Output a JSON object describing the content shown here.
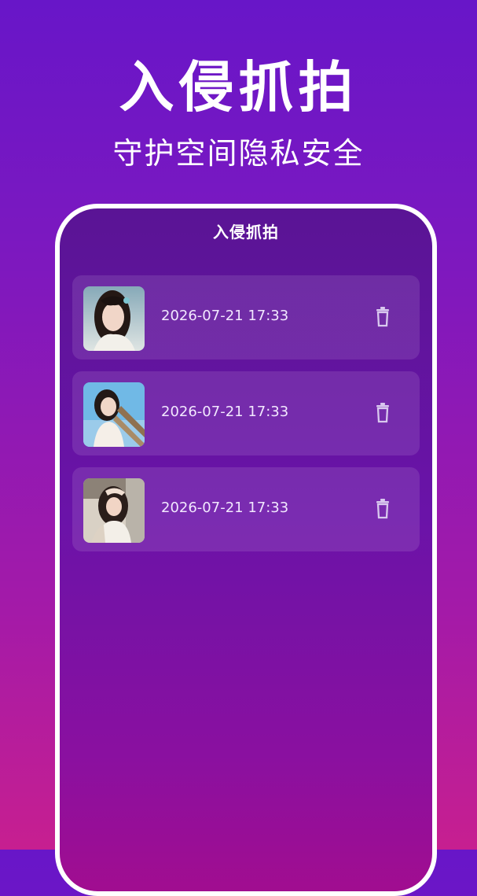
{
  "hero": {
    "title": "入侵抓拍",
    "subtitle": "守护空间隐私安全"
  },
  "screen": {
    "title": "入侵抓拍"
  },
  "records": [
    {
      "time": "2026-07-21 17:33",
      "thumbnail": "portrait-photo-1",
      "delete_icon": "trash-icon"
    },
    {
      "time": "2026-07-21 17:33",
      "thumbnail": "portrait-photo-2",
      "delete_icon": "trash-icon"
    },
    {
      "time": "2026-07-21 17:33",
      "thumbnail": "portrait-photo-3",
      "delete_icon": "trash-icon"
    }
  ],
  "colors": {
    "background_top": "#6816c8",
    "background_bottom": "#c71f90",
    "frame_border": "#ffffff",
    "card_background": "rgba(255,255,255,0.11)",
    "text": "#ffffff"
  }
}
